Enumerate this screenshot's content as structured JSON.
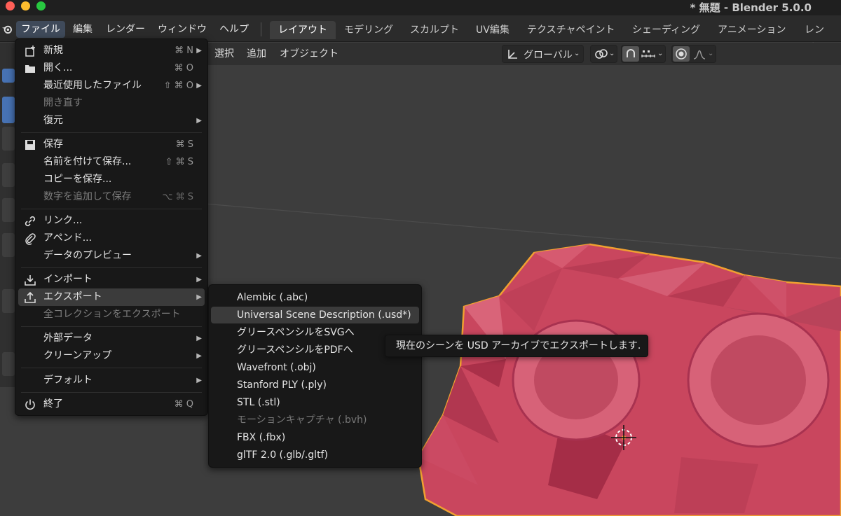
{
  "window": {
    "title": "* 無題 - Blender 5.0.0"
  },
  "topbar": {
    "menus": [
      "ファイル",
      "編集",
      "レンダー",
      "ウィンドウ",
      "ヘルプ"
    ],
    "workspaces": [
      "レイアウト",
      "モデリング",
      "スカルプト",
      "UV編集",
      "テクスチャペイント",
      "シェーディング",
      "アニメーション",
      "レンダリ"
    ]
  },
  "viewport_header": {
    "menus": [
      "選択",
      "追加",
      "オブジェクト"
    ],
    "orientation": "グローバル"
  },
  "file_menu": {
    "new": {
      "label": "新規",
      "shortcut": "⌘ N"
    },
    "open": {
      "label": "開く...",
      "shortcut": "⌘ O"
    },
    "recent": {
      "label": "最近使用したファイル",
      "shortcut": "⇧ ⌘ O"
    },
    "revert": {
      "label": "開き直す"
    },
    "recover": {
      "label": "復元"
    },
    "save": {
      "label": "保存",
      "shortcut": "⌘ S"
    },
    "save_as": {
      "label": "名前を付けて保存...",
      "shortcut": "⇧ ⌘ S"
    },
    "save_copy": {
      "label": "コピーを保存..."
    },
    "save_incremental": {
      "label": "数字を追加して保存",
      "shortcut": "⌥ ⌘ S"
    },
    "link": {
      "label": "リンク..."
    },
    "append": {
      "label": "アペンド..."
    },
    "data_previews": {
      "label": "データのプレビュー"
    },
    "import": {
      "label": "インポート"
    },
    "export": {
      "label": "エクスポート"
    },
    "export_all_collections": {
      "label": "全コレクションをエクスポート"
    },
    "external_data": {
      "label": "外部データ"
    },
    "clean_up": {
      "label": "クリーンアップ"
    },
    "defaults": {
      "label": "デフォルト"
    },
    "quit": {
      "label": "終了",
      "shortcut": "⌘ Q"
    }
  },
  "export_menu": {
    "items": [
      "Alembic (.abc)",
      "Universal Scene Description (.usd*)",
      "グリースペンシルをSVGへ",
      "グリースペンシルをPDFへ",
      "Wavefront (.obj)",
      "Stanford PLY (.ply)",
      "STL (.stl)",
      "モーションキャプチャ (.bvh)",
      "FBX (.fbx)",
      "glTF 2.0 (.glb/.gltf)"
    ]
  },
  "tooltip": {
    "text": "現在のシーンを USD アーカイブでエクスポートします."
  },
  "colors": {
    "menu_bg": "#181818",
    "hover_bg": "#3b3b3b",
    "mesh": "#c8475f",
    "outline": "#f0a030",
    "viewport_bg": "#3d3d3d"
  }
}
